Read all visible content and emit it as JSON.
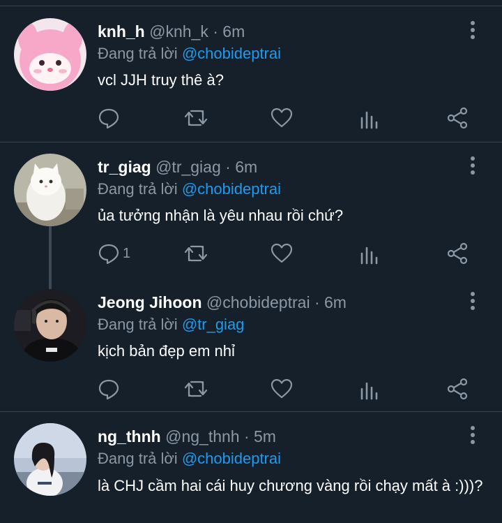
{
  "tweets": [
    {
      "name": "knh_h",
      "handle": "@knh_k · 6m",
      "replying_prefix": "Đang trả lời ",
      "replying_to": "@chobideptrai",
      "text": "vcl JJH truy thê à?",
      "reply_count": ""
    },
    {
      "name": "tr_giag",
      "handle": "@tr_giag · 6m",
      "replying_prefix": "Đang trả lời ",
      "replying_to": "@chobideptrai",
      "text": "ủa tưởng nhận là yêu nhau rồi chứ?",
      "reply_count": "1"
    },
    {
      "name": "Jeong Jihoon",
      "handle": "@chobideptrai · 6m",
      "replying_prefix": "Đang trả lời ",
      "replying_to": "@tr_giag",
      "text": "kịch bản đẹp em nhỉ",
      "reply_count": ""
    },
    {
      "name": "ng_thnh",
      "handle": "@ng_thnh · 5m",
      "replying_prefix": "Đang trả lời ",
      "replying_to": "@chobideptrai",
      "text": "là CHJ cầm hai cái huy chương vàng rồi chạy mất à :)))?",
      "reply_count": ""
    }
  ],
  "colors": {
    "background": "#15202b",
    "mention": "#1d9bf0",
    "muted": "#8b98a5"
  }
}
